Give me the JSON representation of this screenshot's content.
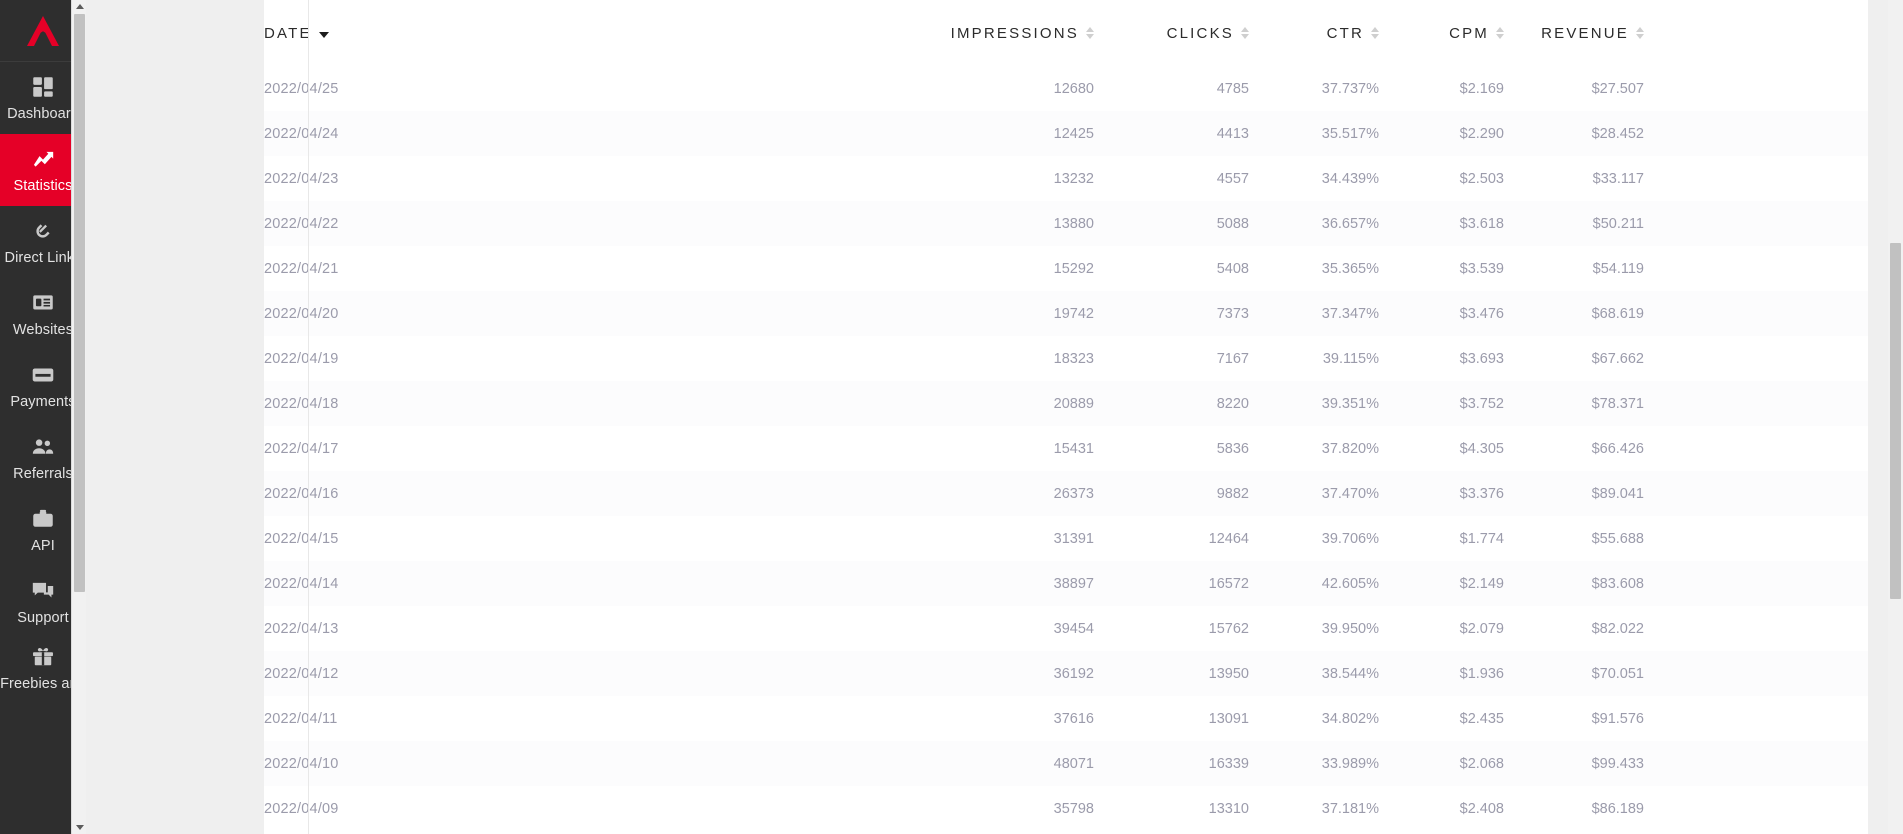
{
  "sidebar": {
    "logo_name": "adsterra-logo",
    "active_color": "#e50027",
    "background": "#2e2e2e",
    "items": [
      {
        "label": "Dashboard",
        "icon": "dashboard-grid-icon",
        "active": false
      },
      {
        "label": "Statistics",
        "icon": "trending-up-icon",
        "active": true
      },
      {
        "label": "Direct Links",
        "icon": "link-chain-icon",
        "active": false
      },
      {
        "label": "Websites",
        "icon": "browser-window-icon",
        "active": false
      },
      {
        "label": "Payments",
        "icon": "credit-card-icon",
        "active": false
      },
      {
        "label": "Referrals",
        "icon": "people-group-icon",
        "active": false
      },
      {
        "label": "API",
        "icon": "briefcase-icon",
        "active": false
      },
      {
        "label": "Support",
        "icon": "chat-bubbles-icon",
        "active": false
      },
      {
        "label": "Freebies and",
        "icon": "gift-box-icon",
        "active": false
      }
    ]
  },
  "table": {
    "columns": [
      {
        "key": "date",
        "label": "DATE",
        "align": "left",
        "sort": "desc"
      },
      {
        "key": "impressions",
        "label": "IMPRESSIONS",
        "align": "right",
        "sort": "none"
      },
      {
        "key": "clicks",
        "label": "CLICKS",
        "align": "right",
        "sort": "none"
      },
      {
        "key": "ctr",
        "label": "CTR",
        "align": "right",
        "sort": "none"
      },
      {
        "key": "cpm",
        "label": "CPM",
        "align": "right",
        "sort": "none"
      },
      {
        "key": "revenue",
        "label": "REVENUE",
        "align": "right",
        "sort": "none"
      }
    ],
    "rows": [
      {
        "date": "2022/04/25",
        "impressions": "12680",
        "clicks": "4785",
        "ctr": "37.737%",
        "cpm": "$2.169",
        "revenue": "$27.507"
      },
      {
        "date": "2022/04/24",
        "impressions": "12425",
        "clicks": "4413",
        "ctr": "35.517%",
        "cpm": "$2.290",
        "revenue": "$28.452"
      },
      {
        "date": "2022/04/23",
        "impressions": "13232",
        "clicks": "4557",
        "ctr": "34.439%",
        "cpm": "$2.503",
        "revenue": "$33.117"
      },
      {
        "date": "2022/04/22",
        "impressions": "13880",
        "clicks": "5088",
        "ctr": "36.657%",
        "cpm": "$3.618",
        "revenue": "$50.211"
      },
      {
        "date": "2022/04/21",
        "impressions": "15292",
        "clicks": "5408",
        "ctr": "35.365%",
        "cpm": "$3.539",
        "revenue": "$54.119"
      },
      {
        "date": "2022/04/20",
        "impressions": "19742",
        "clicks": "7373",
        "ctr": "37.347%",
        "cpm": "$3.476",
        "revenue": "$68.619"
      },
      {
        "date": "2022/04/19",
        "impressions": "18323",
        "clicks": "7167",
        "ctr": "39.115%",
        "cpm": "$3.693",
        "revenue": "$67.662"
      },
      {
        "date": "2022/04/18",
        "impressions": "20889",
        "clicks": "8220",
        "ctr": "39.351%",
        "cpm": "$3.752",
        "revenue": "$78.371"
      },
      {
        "date": "2022/04/17",
        "impressions": "15431",
        "clicks": "5836",
        "ctr": "37.820%",
        "cpm": "$4.305",
        "revenue": "$66.426"
      },
      {
        "date": "2022/04/16",
        "impressions": "26373",
        "clicks": "9882",
        "ctr": "37.470%",
        "cpm": "$3.376",
        "revenue": "$89.041"
      },
      {
        "date": "2022/04/15",
        "impressions": "31391",
        "clicks": "12464",
        "ctr": "39.706%",
        "cpm": "$1.774",
        "revenue": "$55.688"
      },
      {
        "date": "2022/04/14",
        "impressions": "38897",
        "clicks": "16572",
        "ctr": "42.605%",
        "cpm": "$2.149",
        "revenue": "$83.608"
      },
      {
        "date": "2022/04/13",
        "impressions": "39454",
        "clicks": "15762",
        "ctr": "39.950%",
        "cpm": "$2.079",
        "revenue": "$82.022"
      },
      {
        "date": "2022/04/12",
        "impressions": "36192",
        "clicks": "13950",
        "ctr": "38.544%",
        "cpm": "$1.936",
        "revenue": "$70.051"
      },
      {
        "date": "2022/04/11",
        "impressions": "37616",
        "clicks": "13091",
        "ctr": "34.802%",
        "cpm": "$2.435",
        "revenue": "$91.576"
      },
      {
        "date": "2022/04/10",
        "impressions": "48071",
        "clicks": "16339",
        "ctr": "33.989%",
        "cpm": "$2.068",
        "revenue": "$99.433"
      },
      {
        "date": "2022/04/09",
        "impressions": "35798",
        "clicks": "13310",
        "ctr": "37.181%",
        "cpm": "$2.408",
        "revenue": "$86.189"
      }
    ]
  }
}
